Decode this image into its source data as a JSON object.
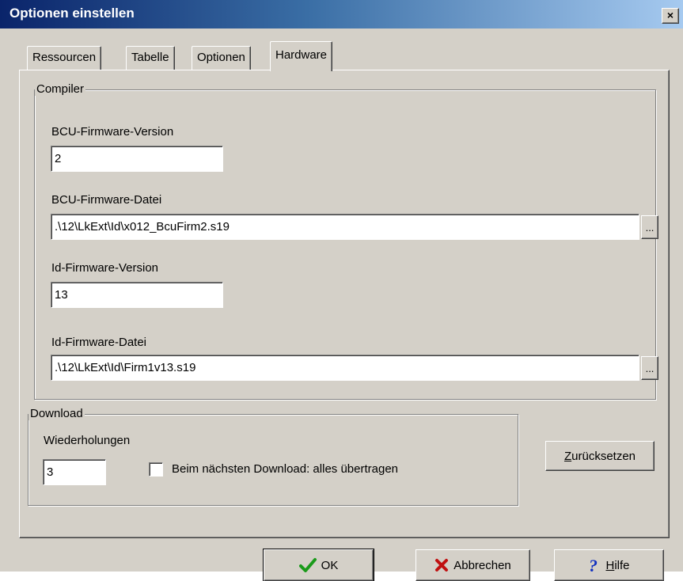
{
  "window": {
    "title": "Optionen einstellen",
    "close_glyph": "×"
  },
  "tabs": [
    {
      "label": "Ressourcen"
    },
    {
      "label": "Tabelle"
    },
    {
      "label": "Optionen"
    },
    {
      "label": "Hardware"
    }
  ],
  "compiler": {
    "legend": "Compiler",
    "bcu_version_label": "BCU-Firmware-Version",
    "bcu_version_value": "2",
    "bcu_file_label": "BCU-Firmware-Datei",
    "bcu_file_value": ".\\12\\LkExt\\Id\\x012_BcuFirm2.s19",
    "id_version_label": "Id-Firmware-Version",
    "id_version_value": "13",
    "id_file_label": "Id-Firmware-Datei",
    "id_file_value": ".\\12\\LkExt\\Id\\Firm1v13.s19",
    "browse_label": "..."
  },
  "download": {
    "legend": "Download",
    "repeat_label": "Wiederholungen",
    "repeat_value": "3",
    "checkbox_label": "Beim nächsten Download: alles übertragen",
    "checkbox_checked": false
  },
  "reset_button": "Zurücksetzen",
  "buttons": {
    "ok": "OK",
    "cancel": "Abbrechen",
    "help": "Hilfe"
  },
  "icons": {
    "ok": "checkmark-icon",
    "cancel": "x-icon",
    "help": "question-icon"
  },
  "colors": {
    "titlebar": "#0a246a",
    "ok_check": "#1a9a1a",
    "cancel_x": "#c01010",
    "help_q": "#1030c0"
  }
}
